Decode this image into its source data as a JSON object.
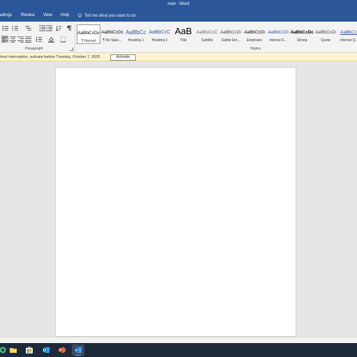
{
  "window": {
    "title": "man  -  Word"
  },
  "tabs": [
    "ailings",
    "Review",
    "View",
    "Help"
  ],
  "search": {
    "placeholder": "Tell me what you want to do"
  },
  "ribbon": {
    "paragraph_label": "Paragraph",
    "styles_label": "Styles",
    "styles": [
      {
        "preview": "AaBbCcDc",
        "name": "¶ Normal",
        "selected": true
      },
      {
        "preview": "AaBbCcDc",
        "name": "¶ No Spac..."
      },
      {
        "preview": "AaBbCc",
        "name": "Heading 1"
      },
      {
        "preview": "AaBbCcC",
        "name": "Heading 2"
      },
      {
        "preview": "AaB",
        "name": "Title"
      },
      {
        "preview": "AaBbCcC",
        "name": "Subtitle"
      },
      {
        "preview": "AaBbCcDı",
        "name": "Subtle Em..."
      },
      {
        "preview": "AaBbCcDı",
        "name": "Emphasis"
      },
      {
        "preview": "AaBbCcDı",
        "name": "Intense E..."
      },
      {
        "preview": "AaBbCcDc",
        "name": "Strong"
      },
      {
        "preview": "AaBbCcDı",
        "name": "Quote"
      },
      {
        "preview": "AaBbCcDı",
        "name": "Intense Q..."
      }
    ]
  },
  "message_bar": {
    "text": "hout interruption, activate before Tuesday, October 7, 2025.",
    "button": "Activate"
  },
  "taskbar": {
    "icons": [
      "copilot-icon",
      "file-explorer-icon",
      "microsoft-store-icon",
      "outlook-icon",
      "powerpoint-icon",
      "word-icon"
    ]
  },
  "colors": {
    "word_blue": "#2b579a",
    "message_bar_bg": "#fff4ce",
    "taskbar_bg": "#1e2a3a"
  }
}
